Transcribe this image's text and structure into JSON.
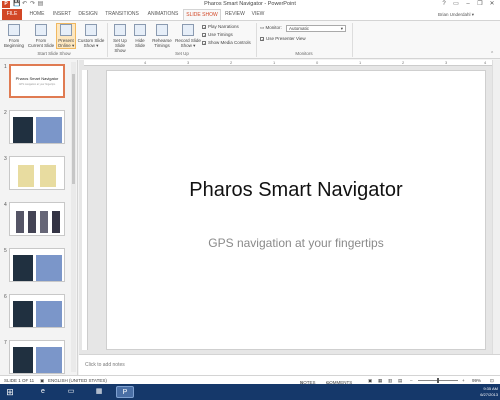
{
  "window": {
    "title": "Pharos Smart Navigator - PowerPoint",
    "app_logo": "P",
    "controls": [
      "?",
      "▭",
      "–",
      "❐",
      "✕"
    ]
  },
  "quick_access": [
    "💾",
    "↶",
    "↷",
    "▤"
  ],
  "tabs": [
    {
      "label": "FILE"
    },
    {
      "label": "HOME"
    },
    {
      "label": "INSERT"
    },
    {
      "label": "DESIGN"
    },
    {
      "label": "TRANSITIONS"
    },
    {
      "label": "ANIMATIONS"
    },
    {
      "label": "SLIDE SHOW"
    },
    {
      "label": "REVIEW"
    },
    {
      "label": "VIEW"
    }
  ],
  "user": "Brian Underdahl ▾",
  "ribbon": {
    "start_group": {
      "label": "Start Slide Show",
      "buttons": [
        {
          "line1": "From",
          "line2": "Beginning"
        },
        {
          "line1": "From",
          "line2": "Current Slide"
        },
        {
          "line1": "Present",
          "line2": "Online ▾"
        },
        {
          "line1": "Custom Slide",
          "line2": "Show ▾"
        }
      ]
    },
    "setup_group": {
      "label": "Set Up",
      "buttons": [
        {
          "line1": "Set Up",
          "line2": "Slide Show"
        },
        {
          "line1": "Hide",
          "line2": "Slide"
        },
        {
          "line1": "Rehearse",
          "line2": "Timings"
        },
        {
          "line1": "Record Slide",
          "line2": "Show ▾"
        }
      ],
      "checkboxes": [
        {
          "label": "Play Narrations",
          "checked": true
        },
        {
          "label": "Use Timings",
          "checked": true
        },
        {
          "label": "Show Media Controls",
          "checked": true
        }
      ]
    },
    "monitors_group": {
      "label": "Monitors",
      "monitor_label": "Monitor:",
      "monitor_value": "Automatic",
      "presenter_view_label": "Use Presenter View",
      "presenter_view_checked": true
    }
  },
  "thumbnails": [
    {
      "num": "1",
      "title": "Pharos Smart Navigator",
      "subtitle": "GPS navigation at your fingertips",
      "selected": true
    },
    {
      "num": "2"
    },
    {
      "num": "3"
    },
    {
      "num": "4"
    },
    {
      "num": "5"
    },
    {
      "num": "6"
    },
    {
      "num": "7"
    }
  ],
  "ruler_marks": [
    "4",
    "3",
    "2",
    "1",
    "0",
    "1",
    "2",
    "3",
    "4"
  ],
  "slide": {
    "title": "Pharos Smart Navigator",
    "subtitle": "GPS navigation at your fingertips"
  },
  "notes_placeholder": "Click to add notes",
  "status": {
    "slide_info": "SLIDE 1 OF 11",
    "language": "ENGLISH (UNITED STATES)",
    "notes": "NOTES",
    "comments": "COMMENTS",
    "zoom": "99%"
  },
  "taskbar": {
    "time": "9:35 AM",
    "date": "6/27/2013"
  },
  "colors": {
    "accent": "#d24726",
    "taskbar": "#15386a"
  }
}
